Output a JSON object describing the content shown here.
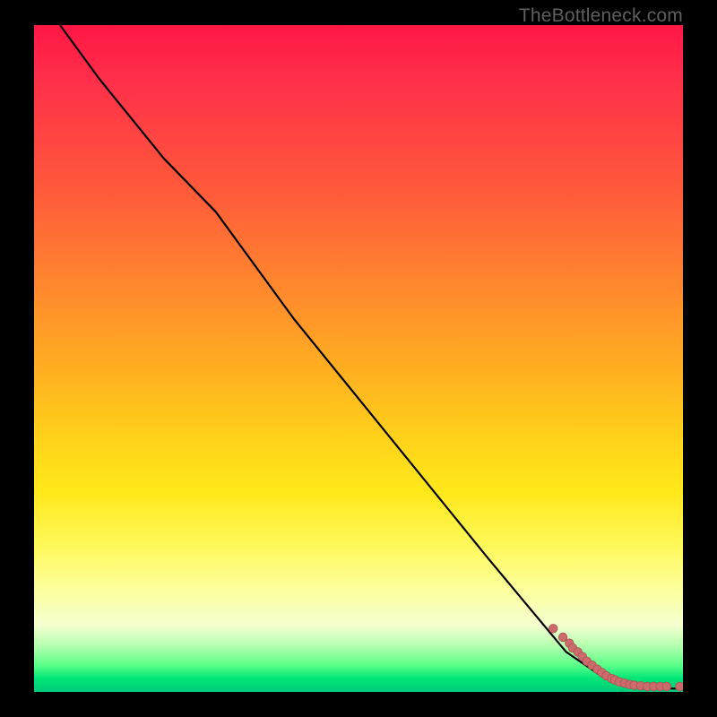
{
  "watermark": "TheBottleneck.com",
  "chart_data": {
    "type": "line",
    "title": "",
    "xlabel": "",
    "ylabel": "",
    "xlim": [
      0,
      100
    ],
    "ylim": [
      0,
      100
    ],
    "curve": {
      "name": "bottleneck-curve",
      "x": [
        4,
        10,
        20,
        28,
        40,
        55,
        70,
        82,
        88,
        92,
        96,
        100
      ],
      "y": [
        100,
        92,
        80,
        72,
        56,
        38,
        20,
        6,
        2,
        1,
        0.5,
        0.5
      ]
    },
    "series": [
      {
        "name": "data-points",
        "x": [
          80,
          81.5,
          82.5,
          83,
          83.8,
          84.5,
          85.2,
          86,
          86.8,
          87.5,
          88.2,
          89,
          89.5,
          90.2,
          91,
          91.8,
          92.5,
          93.5,
          94.5,
          95.5,
          96.5,
          97.5,
          99.5
        ],
        "y": [
          9.5,
          8.2,
          7.3,
          6.6,
          6.0,
          5.3,
          4.6,
          4.0,
          3.4,
          2.9,
          2.4,
          2.0,
          1.8,
          1.5,
          1.3,
          1.1,
          1.0,
          0.9,
          0.8,
          0.8,
          0.8,
          0.8,
          0.8
        ]
      }
    ],
    "colors": {
      "curve": "#000000",
      "points": "#cc6b6b",
      "gradient_top": "#ff1744",
      "gradient_bottom": "#00c97a"
    }
  }
}
